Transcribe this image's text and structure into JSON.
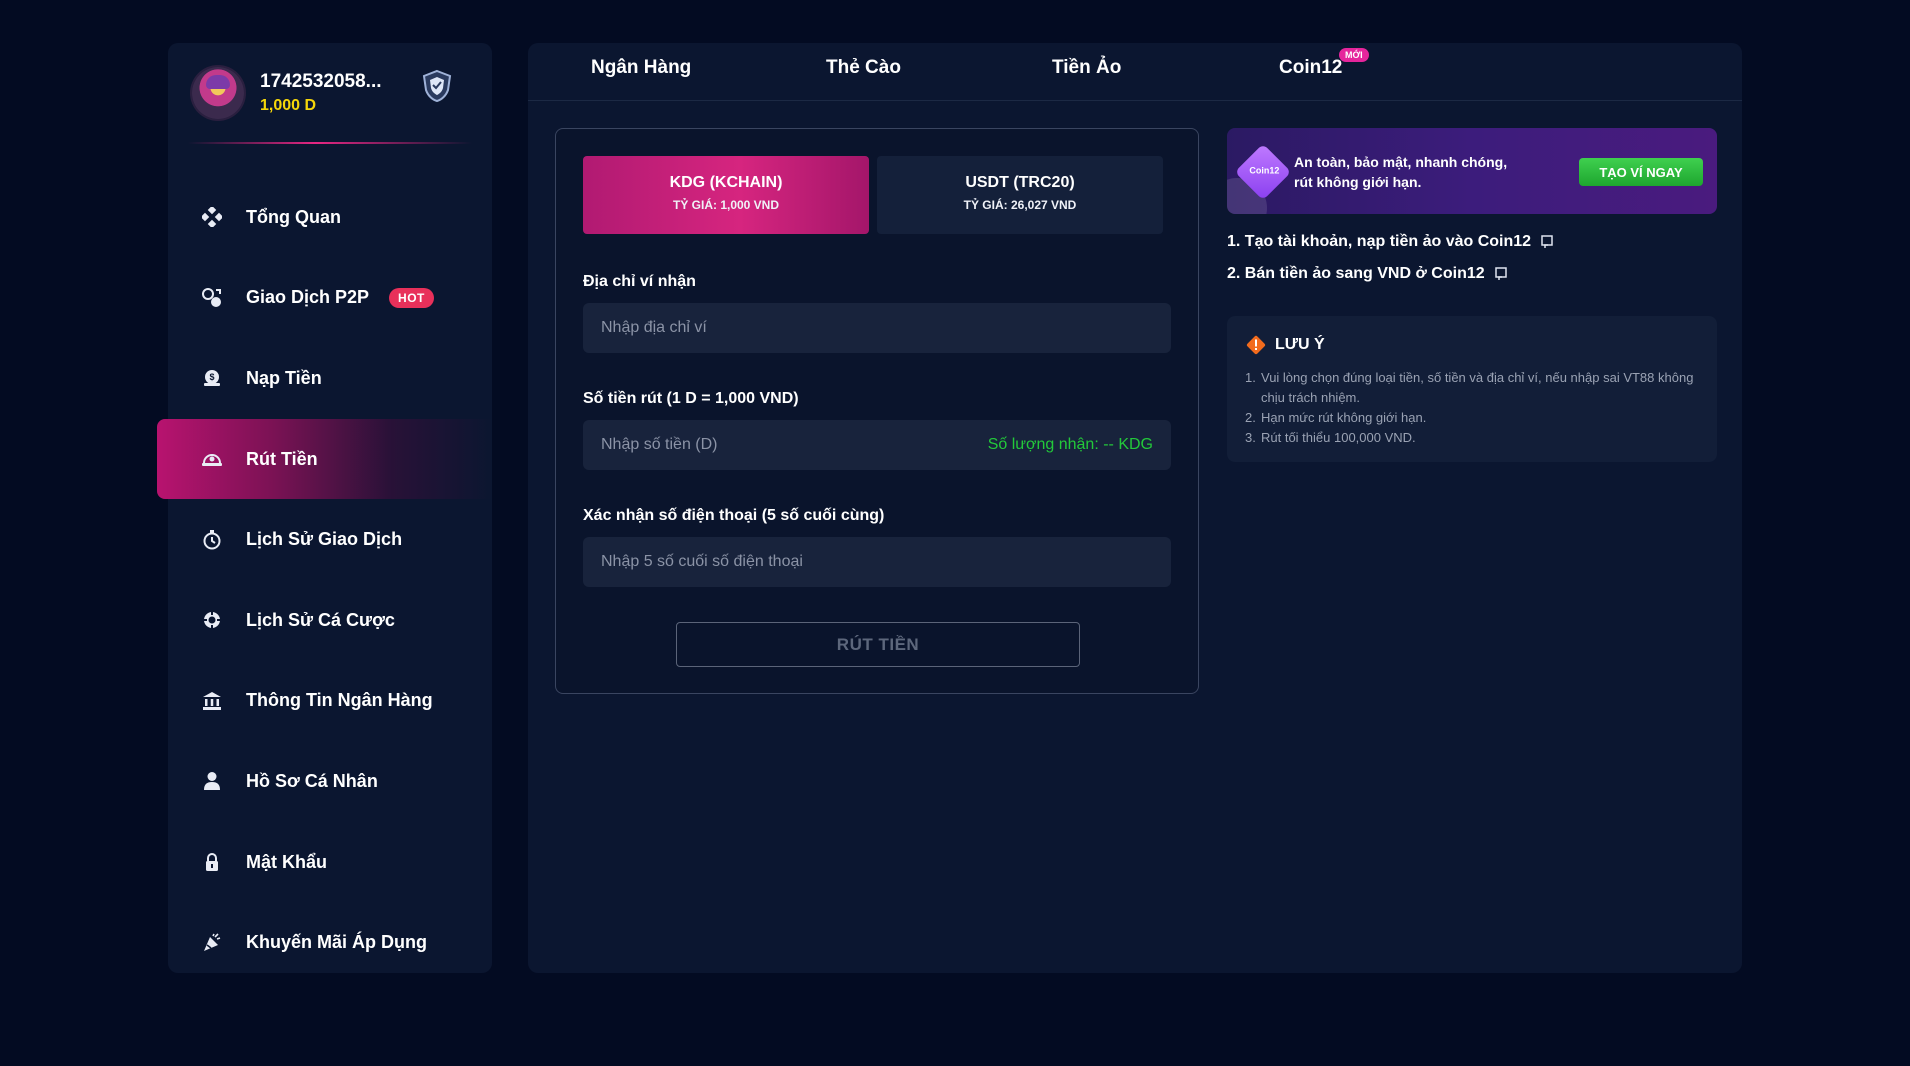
{
  "profile": {
    "username": "1742532058...",
    "balance": "1,000 D"
  },
  "sidebar": {
    "items": [
      {
        "label": "Tổng Quan",
        "icon": "overview-icon"
      },
      {
        "label": "Giao Dịch P2P",
        "icon": "p2p-icon",
        "badge": "HOT"
      },
      {
        "label": "Nạp Tiền",
        "icon": "deposit-icon"
      },
      {
        "label": "Rút Tiền",
        "icon": "withdraw-icon",
        "active": true
      },
      {
        "label": "Lịch Sử Giao Dịch",
        "icon": "transaction-history-icon"
      },
      {
        "label": "Lịch Sử Cá Cược",
        "icon": "bet-history-icon"
      },
      {
        "label": "Thông Tin Ngân Hàng",
        "icon": "bank-icon"
      },
      {
        "label": "Hồ Sơ Cá Nhân",
        "icon": "user-icon"
      },
      {
        "label": "Mật Khẩu",
        "icon": "lock-icon"
      },
      {
        "label": "Khuyến Mãi Áp Dụng",
        "icon": "promotion-icon"
      }
    ]
  },
  "tabs": [
    {
      "label": "Ngân Hàng"
    },
    {
      "label": "Thẻ Cào"
    },
    {
      "label": "Tiền Ảo"
    },
    {
      "label": "Coin12",
      "badge": "MỚI",
      "active": true
    }
  ],
  "form": {
    "coins": [
      {
        "title": "KDG (KCHAIN)",
        "rate": "TỶ GIÁ: 1,000 VND",
        "selected": true
      },
      {
        "title": "USDT (TRC20)",
        "rate": "TỶ GIÁ: 26,027 VND",
        "selected": false
      }
    ],
    "address_label": "Địa chỉ ví nhận",
    "address_placeholder": "Nhập địa chỉ ví",
    "amount_label": "Số tiền rút (1 D = 1,000 VND)",
    "amount_placeholder": "Nhập số tiền (D)",
    "receive_note": "Số lượng nhận: -- KDG",
    "phone_label": "Xác nhận số điện thoại (5 số cuối cùng)",
    "phone_placeholder": "Nhập 5 số cuối số điện thoại",
    "submit_label": "RÚT TIỀN"
  },
  "promo": {
    "logo_text": "Coin12",
    "text": "An toàn, bảo mật, nhanh chóng, rút không giới hạn.",
    "button_label": "TẠO VÍ NGAY"
  },
  "guides": [
    {
      "label": "1. Tạo tài khoản, nạp tiền ảo vào Coin12"
    },
    {
      "label": "2. Bán tiền ảo sang VND ở Coin12"
    }
  ],
  "notice": {
    "title": "LƯU Ý",
    "items": [
      {
        "num": "1.",
        "text": "Vui lòng chọn đúng loại tiền, số tiền và địa chỉ ví, nếu nhập sai VT88 không chịu trách nhiệm."
      },
      {
        "num": "2.",
        "text": "Hạn mức rút không giới hạn."
      },
      {
        "num": "3.",
        "text": "Rút tối thiểu 100,000 VND."
      }
    ]
  },
  "colors": {
    "background": "#030b22",
    "panel": "#0b1630",
    "accent_pink": "#d6257f",
    "balance_yellow": "#f5d60a",
    "success_green": "#23c93a",
    "hot_red": "#e8305a"
  }
}
